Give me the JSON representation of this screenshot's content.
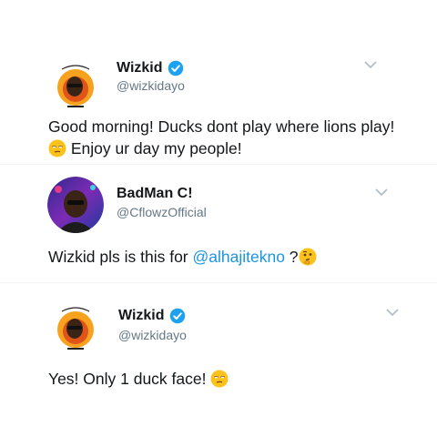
{
  "tweets": [
    {
      "name": "Wizkid",
      "verified": true,
      "handle": "@wizkidayo",
      "avatar_icon": "wizkid-avatar",
      "text_line1": "Good morning! Ducks dont play where lions play!",
      "emoji1": "unamused-face-emoji",
      "text_line2": "Enjoy ur day my people!"
    },
    {
      "name": "BadMan C!",
      "verified": false,
      "handle": "@CflowzOfficial",
      "avatar_icon": "badman-avatar",
      "text_prefix": "Wizkid pls is this for ",
      "mention": "@alhajitekno",
      "text_suffix": " ?",
      "emoji": "thinking-face-emoji"
    },
    {
      "name": "Wizkid",
      "verified": true,
      "handle": "@wizkidayo",
      "avatar_icon": "wizkid-avatar",
      "text": "Yes! Only 1 duck face!",
      "emoji": "unamused-face-emoji"
    }
  ],
  "colors": {
    "verified": "#1da1f2",
    "mention": "#1b95e0",
    "handle": "#657786",
    "chevron": "#b0bec8"
  }
}
